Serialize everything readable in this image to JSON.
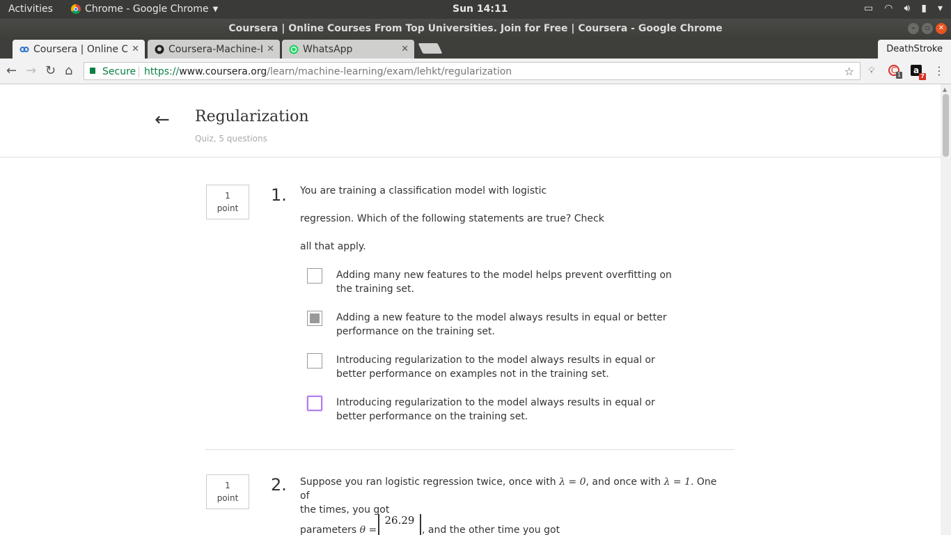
{
  "topbar": {
    "activities": "Activities",
    "app_menu": "Chrome - Google Chrome",
    "clock": "Sun 14:11"
  },
  "window": {
    "title": "Coursera | Online Courses From Top Universities. Join for Free | Coursera - Google Chrome"
  },
  "tabs": [
    {
      "label": "Coursera | Online C",
      "icon": "coursera-icon"
    },
    {
      "label": "Coursera-Machine-L",
      "icon": "github-icon"
    },
    {
      "label": "WhatsApp",
      "icon": "whatsapp-icon"
    }
  ],
  "profile": "DeathStroke",
  "address_bar": {
    "secure_label": "Secure",
    "url_scheme": "https://",
    "url_host": "www.coursera.org",
    "url_path": "/learn/machine-learning/exam/lehkt/regularization"
  },
  "extensions": {
    "ext1_badge": "1",
    "ext2_badge": "7"
  },
  "quiz": {
    "title": "Regularization",
    "subtitle": "Quiz, 5 questions"
  },
  "questions": [
    {
      "points_value": "1",
      "points_unit": "point",
      "number": "1.",
      "lines": [
        "You are training a classification model with logistic",
        "regression. Which of the following statements are true? Check",
        "all that apply."
      ],
      "options": [
        {
          "label": "Adding many new features to the model helps prevent overfitting on the training set.",
          "checked": false
        },
        {
          "label": "Adding a new feature to the model always results in equal or better performance on the training set.",
          "checked": true
        },
        {
          "label": "Introducing regularization to the model always results in equal or better performance on examples not in the training set.",
          "checked": false
        },
        {
          "label": "Introducing regularization to the model always results in equal or better performance on the training set.",
          "checked": false
        }
      ]
    },
    {
      "points_value": "1",
      "points_unit": "point",
      "number": "2.",
      "text_a": "Suppose you ran logistic regression twice, once with ",
      "lambda0": "λ = 0",
      "text_b": ", and once with ",
      "lambda1": "λ = 1",
      "text_c": ". One of",
      "line2": "the times, you got",
      "line3_a": "parameters ",
      "theta": "θ = ",
      "matrix_top": "26.29",
      "line3_b": ", and the other time you got"
    }
  ]
}
